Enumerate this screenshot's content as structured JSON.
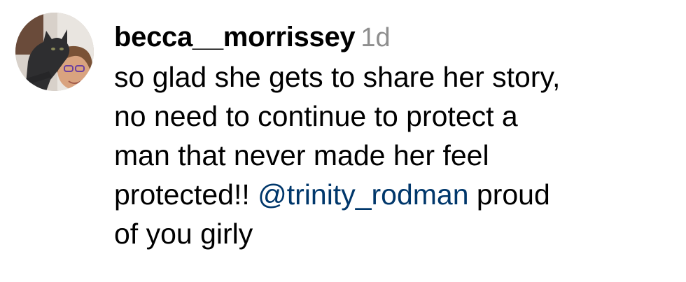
{
  "comment": {
    "username": "becca__morrissey",
    "timestamp": "1d",
    "avatar_icon": "profile-photo-cat-and-person",
    "lines": [
      "so glad she gets to share her story,",
      "no need to continue to protect a",
      "man that never made her feel"
    ],
    "line4_before": "protected!! ",
    "mention": "@trinity_rodman",
    "line4_after": " proud",
    "line5": "of you girly",
    "mention_color": "#00376b",
    "timestamp_color": "#8e8e8e"
  }
}
